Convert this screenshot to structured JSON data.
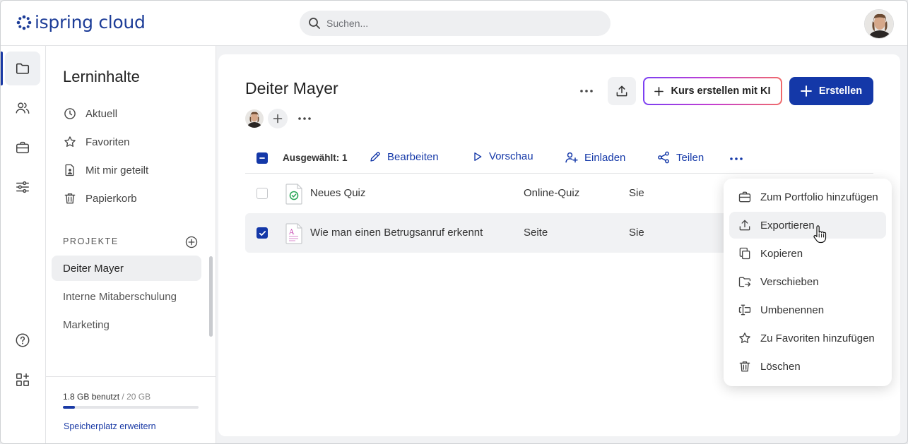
{
  "app": {
    "logo_text": "ispring cloud"
  },
  "search": {
    "placeholder": "Suchen..."
  },
  "sidebar": {
    "title": "Lerninhalte",
    "items": [
      {
        "label": "Aktuell",
        "icon": "clock-icon"
      },
      {
        "label": "Favoriten",
        "icon": "star-icon"
      },
      {
        "label": "Mit mir geteilt",
        "icon": "shared-file-icon"
      },
      {
        "label": "Papierkorb",
        "icon": "trash-icon"
      }
    ],
    "projects_heading": "PROJEKTE",
    "projects": [
      {
        "label": "Deiter Mayer",
        "active": true
      },
      {
        "label": "Interne Mitaberschulung",
        "active": false
      },
      {
        "label": "Marketing",
        "active": false
      }
    ],
    "storage": {
      "used": "1.8 GB benutzt",
      "total": " / 20 GB",
      "used_fraction": 0.09,
      "link": "Speicherplatz erweitern"
    }
  },
  "main": {
    "title": "Deiter Mayer",
    "ki_button": "Kurs erstellen mit KI",
    "create_button": "Erstellen",
    "toolbar": {
      "selected": "Ausgewählt: 1",
      "edit": "Bearbeiten",
      "preview": "Vorschau",
      "invite": "Einladen",
      "share": "Teilen"
    },
    "rows": [
      {
        "name": "Neues Quiz",
        "type": "Online-Quiz",
        "owner": "Sie",
        "checked": false
      },
      {
        "name": "Wie man einen Betrugsanruf erkennt",
        "type": "Seite",
        "owner": "Sie",
        "checked": true
      }
    ]
  },
  "context_menu": {
    "items": [
      {
        "label": "Zum Portfolio hinzufügen",
        "icon": "briefcase-icon"
      },
      {
        "label": "Exportieren",
        "icon": "export-icon",
        "hover": true
      },
      {
        "label": "Kopieren",
        "icon": "copy-icon"
      },
      {
        "label": "Verschieben",
        "icon": "move-folder-icon"
      },
      {
        "label": "Umbenennen",
        "icon": "rename-icon"
      },
      {
        "label": "Zu Favoriten hinzufügen",
        "icon": "star-icon"
      },
      {
        "label": "Löschen",
        "icon": "trash-icon"
      }
    ]
  },
  "colors": {
    "brand": "#1438a8",
    "accent_gradient": [
      "#7b3ff2",
      "#c43fd2",
      "#f06a6a"
    ]
  }
}
